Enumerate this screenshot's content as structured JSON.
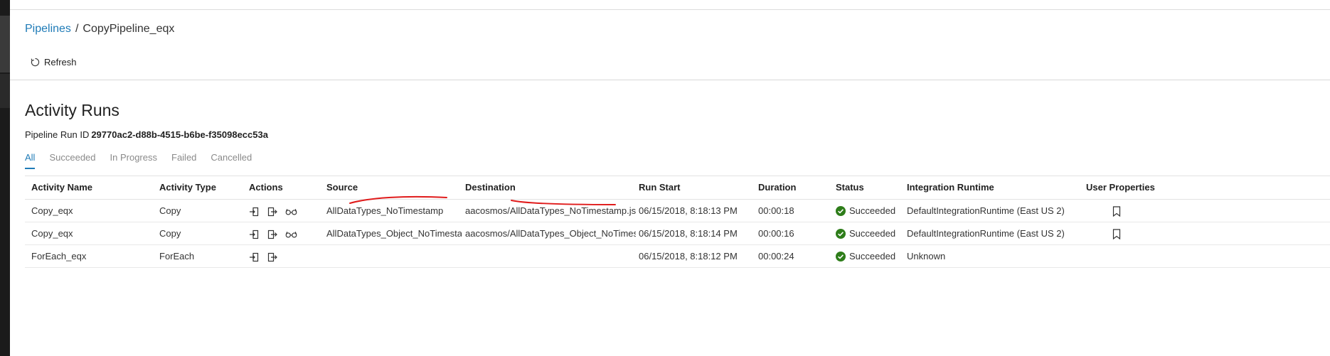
{
  "breadcrumb": {
    "root": "Pipelines",
    "separator": "/",
    "current": "CopyPipeline_eqx"
  },
  "toolbar": {
    "refresh_label": "Refresh",
    "refresh_icon": "refresh-icon"
  },
  "page": {
    "title": "Activity Runs",
    "run_id_label": "Pipeline Run ID",
    "run_id_value": "29770ac2-d88b-4515-b6be-f35098ecc53a"
  },
  "tabs": [
    {
      "label": "All",
      "active": true
    },
    {
      "label": "Succeeded",
      "active": false
    },
    {
      "label": "In Progress",
      "active": false
    },
    {
      "label": "Failed",
      "active": false
    },
    {
      "label": "Cancelled",
      "active": false
    }
  ],
  "table": {
    "headers": [
      "Activity Name",
      "Activity Type",
      "Actions",
      "Source",
      "Destination",
      "Run Start",
      "Duration",
      "Status",
      "Integration Runtime",
      "User Properties"
    ],
    "rows": [
      {
        "name": "Copy_eqx",
        "type": "Copy",
        "source": "AllDataTypes_NoTimestamp",
        "destination": "aacosmos/AllDataTypes_NoTimestamp.json",
        "run_start": "06/15/2018, 8:18:13 PM",
        "duration": "00:00:18",
        "status": "Succeeded",
        "runtime": "DefaultIntegrationRuntime (East US 2)"
      },
      {
        "name": "Copy_eqx",
        "type": "Copy",
        "source": "AllDataTypes_Object_NoTimestamp",
        "destination": "aacosmos/AllDataTypes_Object_NoTimestamp.json",
        "run_start": "06/15/2018, 8:18:14 PM",
        "duration": "00:00:16",
        "status": "Succeeded",
        "runtime": "DefaultIntegrationRuntime (East US 2)"
      },
      {
        "name": "ForEach_eqx",
        "type": "ForEach",
        "source": "",
        "destination": "",
        "run_start": "06/15/2018, 8:18:12 PM",
        "duration": "00:00:24",
        "status": "Succeeded",
        "runtime": "Unknown"
      }
    ]
  },
  "colors": {
    "link": "#1f7bb7",
    "success": "#2e7d1a",
    "annotation": "#e01b1b",
    "sidebar": "#1b1b1b"
  }
}
